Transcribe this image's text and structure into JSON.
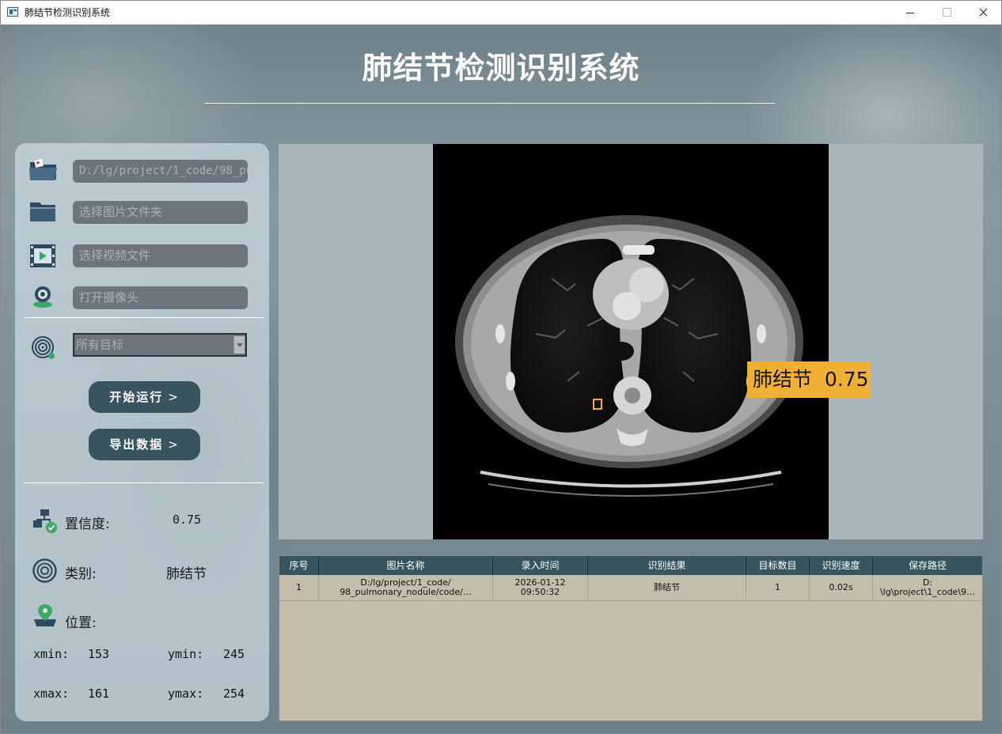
{
  "window": {
    "title": "肺结节检测识别系统"
  },
  "header": {
    "title": "肺结节检测识别系统"
  },
  "inputs": {
    "image_file": "D:/lg/project/1_code/98_pul",
    "image_folder_placeholder": "选择图片文件夹",
    "video_file_placeholder": "选择视频文件",
    "camera_placeholder": "打开摄像头"
  },
  "target_select": {
    "selected": "所有目标"
  },
  "buttons": {
    "run": "开始运行",
    "export": "导出数据",
    "chevron": ">"
  },
  "result": {
    "confidence_label": "置信度:",
    "confidence_value": "0.75",
    "class_label": "类别:",
    "class_value": "肺结节",
    "position_label": "位置:",
    "xmin_label": "xmin:",
    "xmin": "153",
    "ymin_label": "ymin:",
    "ymin": "245",
    "xmax_label": "xmax:",
    "xmax": "161",
    "ymax_label": "ymax:",
    "ymax": "254"
  },
  "detection": {
    "label": "肺结节",
    "score": "0.75",
    "color": "#efb033"
  },
  "table": {
    "headers": [
      "序号",
      "图片名称",
      "录入时间",
      "识别结果",
      "目标数目",
      "识别速度",
      "保存路径"
    ],
    "rows": [
      {
        "index": "1",
        "name_line1": "D:/lg/project/1_code/",
        "name_line2": "98_pulmonary_nodule/code/…",
        "time_line1": "2026-01-12",
        "time_line2": "09:50:32",
        "result": "肺结节",
        "count": "1",
        "speed": "0.02s",
        "path_line1": "D:",
        "path_line2": "\\lg\\project\\1_code\\9…"
      }
    ]
  },
  "colors": {
    "accent": "#37545f",
    "table_bg": "#c5bdac"
  }
}
